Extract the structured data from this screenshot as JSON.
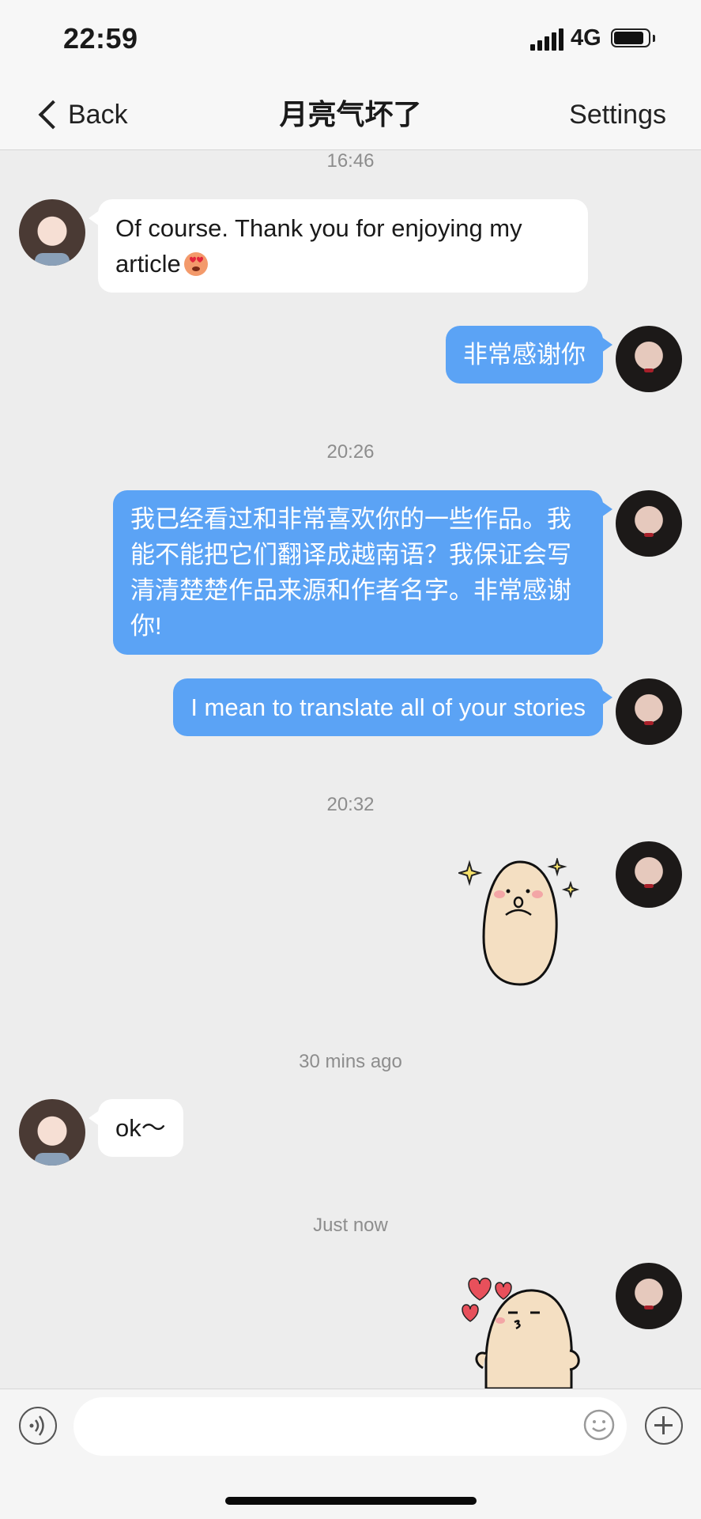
{
  "status_bar": {
    "time": "22:59",
    "network": "4G",
    "icons": [
      "cellular-signal-icon",
      "battery-icon"
    ]
  },
  "nav": {
    "back_label": "Back",
    "title": "月亮气坏了",
    "settings_label": "Settings"
  },
  "conversation": {
    "timestamps": [
      "16:46",
      "20:26",
      "20:32",
      "30 mins ago",
      "Just now"
    ],
    "messages": [
      {
        "from": "other",
        "text": "Of course. Thank you for enjoying my article",
        "emoji": "heart-eyes-emoji"
      },
      {
        "from": "me",
        "text": "非常感谢你"
      },
      {
        "from": "me",
        "text": "我已经看过和非常喜欢你的一些作品。我能不能把它们翻译成越南语？我保证会写清清楚楚作品来源和作者名字。非常感谢你!"
      },
      {
        "from": "me",
        "text": "I mean to translate all of your stories"
      },
      {
        "from": "me",
        "sticker": "sparkle-potato-sticker"
      },
      {
        "from": "other",
        "text": "ok～"
      },
      {
        "from": "me",
        "sticker": "kissing-potato-hearts-sticker"
      }
    ]
  },
  "input_bar": {
    "placeholder": "",
    "icons": [
      "voice-icon",
      "emoji-icon",
      "plus-icon"
    ]
  },
  "colors": {
    "background": "#ededed",
    "outgoing_bubble": "#5ba3f5",
    "incoming_bubble": "#ffffff",
    "bar": "#f7f7f7"
  }
}
